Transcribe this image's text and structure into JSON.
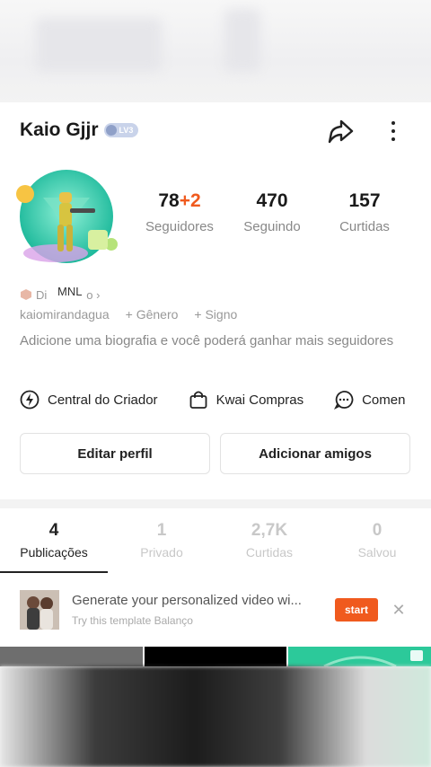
{
  "profile": {
    "username": "Kaio Gjjr",
    "level": "LV3",
    "handle": "kaiomirandagua",
    "badge_text": "Di",
    "badge_suffix": "o ›",
    "badge_overlay": "MNL",
    "gender": "+ Gênero",
    "sign": "+ Signo",
    "bio": "Adicione uma biografia e você poderá ganhar mais seguidores"
  },
  "stats": [
    {
      "value": "78",
      "increment": "+2",
      "label": "Seguidores"
    },
    {
      "value": "470",
      "increment": "",
      "label": "Seguindo"
    },
    {
      "value": "157",
      "increment": "",
      "label": "Curtidas"
    }
  ],
  "tools": [
    {
      "label": "Central do Criador",
      "icon": "bolt-icon"
    },
    {
      "label": "Kwai Compras",
      "icon": "shopping-bag-icon"
    },
    {
      "label": "Comen",
      "icon": "comment-icon"
    }
  ],
  "buttons": {
    "edit": "Editar perfil",
    "add_friends": "Adicionar amigos"
  },
  "tabs": [
    {
      "count": "4",
      "label": "Publicações",
      "active": true
    },
    {
      "count": "1",
      "label": "Privado",
      "active": false
    },
    {
      "count": "2,7K",
      "label": "Curtidas",
      "active": false
    },
    {
      "count": "0",
      "label": "Salvou",
      "active": false
    }
  ],
  "promo": {
    "title": "Generate your personalized video wi...",
    "subtitle": "Try this template Balanço",
    "button": "start"
  },
  "colors": {
    "accent": "#f05a1e",
    "text": "#222222",
    "muted": "#888888"
  }
}
